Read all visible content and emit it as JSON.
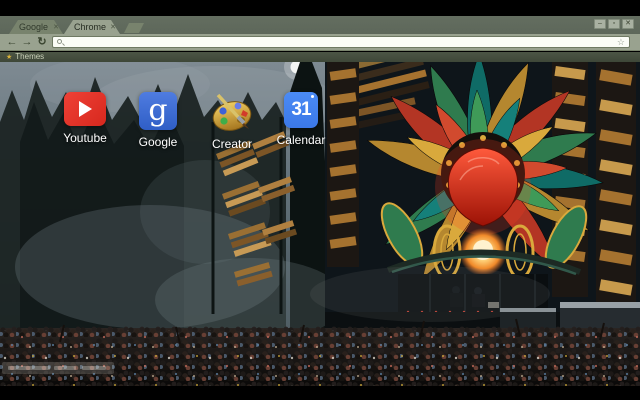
{
  "window_controls": {
    "minimize": "–",
    "maximize": "▫",
    "close": "✕"
  },
  "tabs": [
    {
      "label": "Google",
      "active": false
    },
    {
      "label": "Chrome",
      "active": true
    }
  ],
  "tab_close_glyph": "✕",
  "toolbar": {
    "back_glyph": "←",
    "forward_glyph": "→",
    "reload_glyph": "↻",
    "address_value": "",
    "bookmark_star_glyph": "☆"
  },
  "bookmarks_bar": {
    "items": [
      {
        "label": "Themes"
      }
    ],
    "star_glyph": "★"
  },
  "new_tab_page": {
    "shortcuts": [
      {
        "label": "Youtube",
        "icon": "youtube-play-icon"
      },
      {
        "label": "Google",
        "icon": "google-g-icon",
        "glyph": "g"
      },
      {
        "label": "Creator",
        "icon": "artist-palette-icon"
      },
      {
        "label": "Calendar",
        "icon": "calendar-icon",
        "glyph": "31"
      }
    ]
  },
  "colors": {
    "frame": "#5d675a",
    "toolbar": "#99a28f",
    "bookmarks_bar": "#454e42",
    "youtube_red": "#e02d22",
    "google_blue": "#3b68cf",
    "calendar_blue": "#4285f4",
    "stage_gold": "#d9a93c",
    "stage_red": "#c0392b",
    "stage_green": "#2f7b4e"
  }
}
